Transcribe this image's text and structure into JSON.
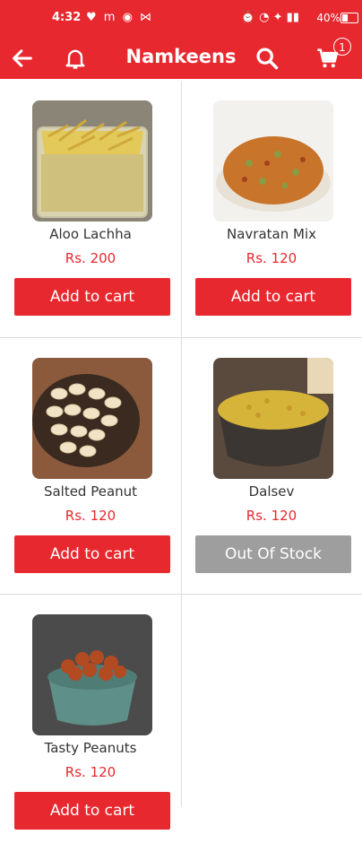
{
  "status_bar": {
    "time": "4:32",
    "left_icons": "♥ m ◉ ⋈",
    "right_icons": "⏰ 0.08 ✈ Vo 40%",
    "battery_pct": "40%"
  },
  "app_bar": {
    "title": "Namkeens",
    "cart_count": "1",
    "accent_color": "#e8282f"
  },
  "products": [
    {
      "name": "Aloo Lachha",
      "price": "Rs. 200",
      "button": "Add to cart",
      "in_stock": true
    },
    {
      "name": "Navratan Mix",
      "price": "Rs. 120",
      "button": "Add to cart",
      "in_stock": true
    },
    {
      "name": "Salted Peanut",
      "price": "Rs. 120",
      "button": "Add to cart",
      "in_stock": true
    },
    {
      "name": "Dalsev",
      "price": "Rs. 120",
      "button": "Out Of Stock",
      "in_stock": false
    },
    {
      "name": "Tasty Peanuts",
      "price": "Rs. 120",
      "button": "Add to cart",
      "in_stock": true
    }
  ]
}
